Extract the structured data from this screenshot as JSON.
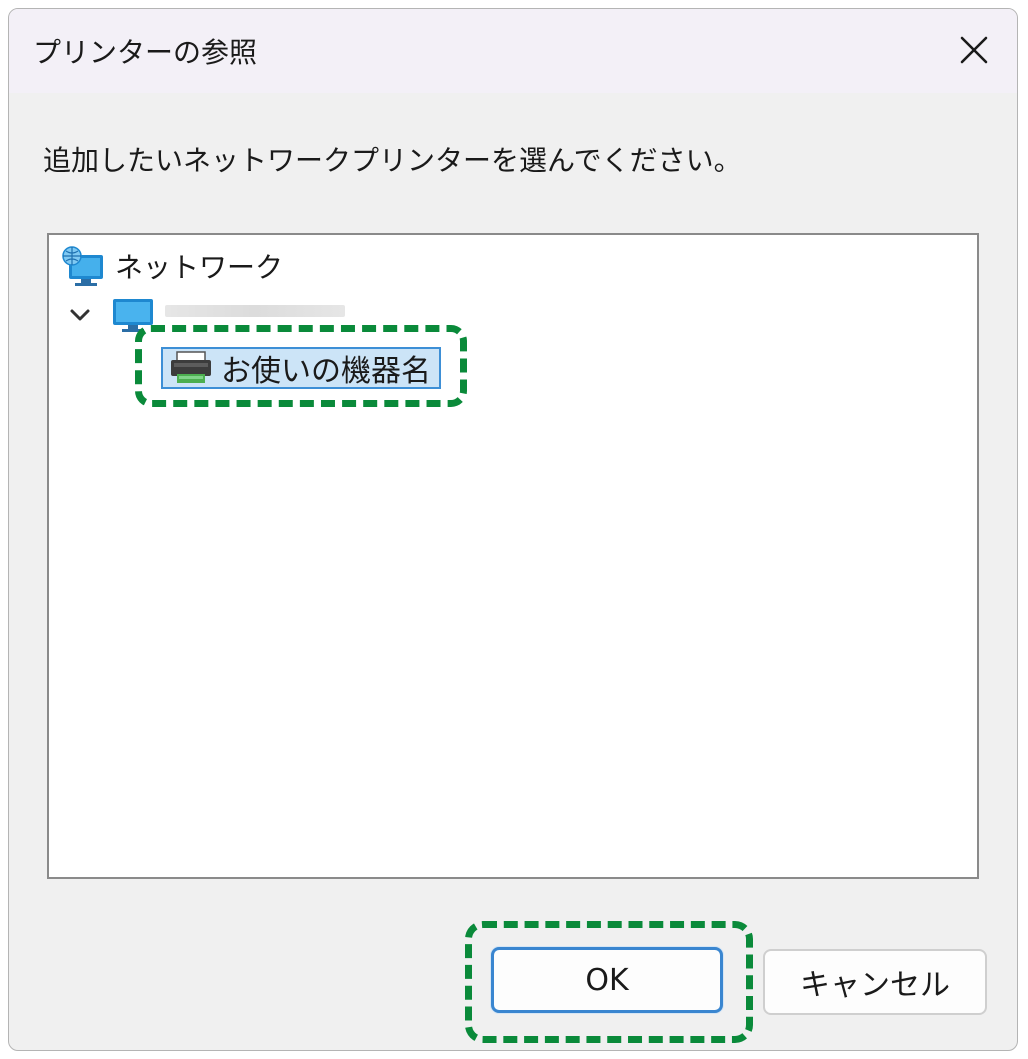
{
  "window": {
    "title": "プリンターの参照",
    "close_icon": "close-icon"
  },
  "instruction": "追加したいネットワークプリンターを選んでください。",
  "tree": {
    "root": {
      "label": "ネットワーク",
      "icon": "network-icon"
    },
    "computer": {
      "icon": "computer-icon",
      "expanded": true,
      "name_obscured": true
    },
    "printer": {
      "label": "お使いの機器名",
      "icon": "printer-icon",
      "selected": true
    }
  },
  "buttons": {
    "ok_label": "OK",
    "cancel_label": "キャンセル"
  },
  "colors": {
    "highlight_dashed": "#0a8a3a",
    "selection_fill": "#cce4f7",
    "selection_border": "#3d8fd6",
    "ok_border": "#3a86d0"
  }
}
